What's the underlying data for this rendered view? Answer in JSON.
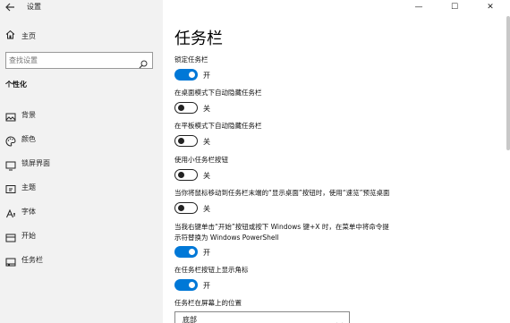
{
  "window": {
    "title": "设置",
    "minimize_glyph": "—",
    "maximize_glyph": "☐",
    "close_glyph": "✕"
  },
  "sidebar": {
    "home_label": "主页",
    "search_placeholder": "查找设置",
    "section_title": "个性化",
    "items": [
      {
        "label": "背景",
        "icon": "picture-icon"
      },
      {
        "label": "颜色",
        "icon": "palette-icon"
      },
      {
        "label": "锁屏界面",
        "icon": "lock-screen-icon"
      },
      {
        "label": "主题",
        "icon": "theme-brush-icon"
      },
      {
        "label": "字体",
        "icon": "font-icon"
      },
      {
        "label": "开始",
        "icon": "start-menu-icon"
      },
      {
        "label": "任务栏",
        "icon": "taskbar-icon"
      }
    ]
  },
  "main": {
    "title": "任务栏",
    "settings": [
      {
        "label": "锁定任务栏",
        "state": "开",
        "on": true
      },
      {
        "label": "在桌面模式下自动隐藏任务栏",
        "state": "关",
        "on": false
      },
      {
        "label": "在平板模式下自动隐藏任务栏",
        "state": "关",
        "on": false
      },
      {
        "label": "使用小任务栏按钮",
        "state": "关",
        "on": false
      },
      {
        "label": "当你将鼠标移动到任务栏末端的“显示桌面”按钮时，使用“速览”预览桌面",
        "state": "关",
        "on": false
      },
      {
        "label": "当我右键单击“开始”按钮或按下 Windows 键+X 时，在菜单中将命令提",
        "label2": "示符替换为 Windows PowerShell",
        "state": "开",
        "on": true
      },
      {
        "label": "在任务栏按钮上显示角标",
        "state": "开",
        "on": true
      }
    ],
    "position_label": "任务栏在屏幕上的位置",
    "position_value": "底部"
  },
  "colors": {
    "accent": "#0078d7",
    "sidebar_bg": "#f2f2f2"
  }
}
